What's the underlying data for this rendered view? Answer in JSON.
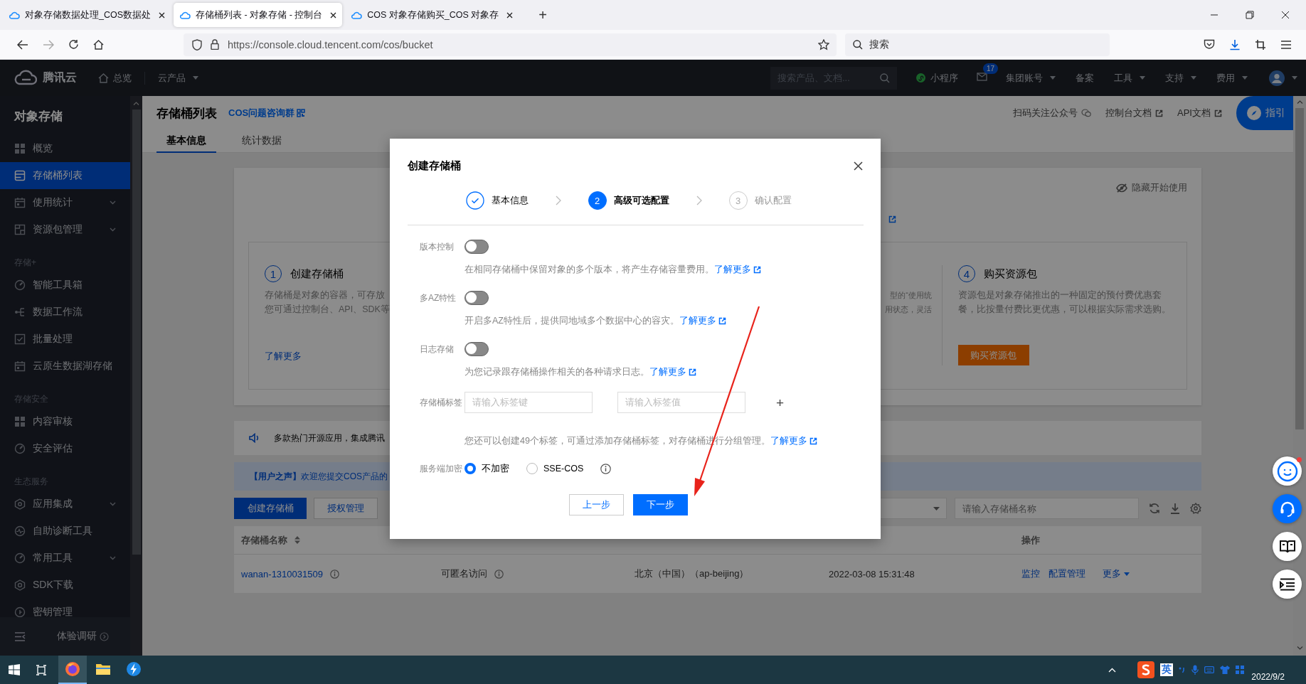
{
  "browser": {
    "tabs": [
      {
        "title": "对象存储数据处理_COS数据处",
        "selected": false
      },
      {
        "title": "存储桶列表 - 对象存储 - 控制台",
        "selected": true
      },
      {
        "title": "COS 对象存储购买_COS 对象存",
        "selected": false
      }
    ],
    "new_tab": "+",
    "url": "https://console.cloud.tencent.com/cos/bucket",
    "search_placeholder": "搜索"
  },
  "console_nav": {
    "brand": "腾讯云",
    "overview": "总览",
    "products": "云产品",
    "search_placeholder": "搜索产品、文档...",
    "mini_program": "小程序",
    "mail_badge": "17",
    "menus": [
      {
        "label": "集团账号",
        "dropdown": true
      },
      {
        "label": "备案",
        "dropdown": false
      },
      {
        "label": "工具",
        "dropdown": true
      },
      {
        "label": "支持",
        "dropdown": true
      },
      {
        "label": "费用",
        "dropdown": true
      }
    ]
  },
  "sidebar": {
    "title": "对象存储",
    "sections": [
      {
        "items": [
          {
            "label": "概览",
            "selected": false,
            "submenu": false
          },
          {
            "label": "存储桶列表",
            "selected": true,
            "submenu": false
          },
          {
            "label": "使用统计",
            "selected": false,
            "submenu": true
          },
          {
            "label": "资源包管理",
            "selected": false,
            "submenu": true
          }
        ]
      },
      {
        "heading": "存储+",
        "items": [
          {
            "label": "智能工具箱",
            "selected": false,
            "submenu": false
          },
          {
            "label": "数据工作流",
            "selected": false,
            "submenu": false
          },
          {
            "label": "批量处理",
            "selected": false,
            "submenu": false
          },
          {
            "label": "云原生数据湖存储",
            "selected": false,
            "submenu": false
          }
        ]
      },
      {
        "heading": "存储安全",
        "items": [
          {
            "label": "内容审核",
            "selected": false,
            "submenu": false
          },
          {
            "label": "安全评估",
            "selected": false,
            "submenu": false
          }
        ]
      },
      {
        "heading": "生态服务",
        "items": [
          {
            "label": "应用集成",
            "selected": false,
            "submenu": true
          },
          {
            "label": "自助诊断工具",
            "selected": false,
            "submenu": false
          },
          {
            "label": "常用工具",
            "selected": false,
            "submenu": true
          },
          {
            "label": "SDK下载",
            "selected": false,
            "submenu": false
          },
          {
            "label": "密钥管理",
            "selected": false,
            "submenu": false
          }
        ]
      }
    ],
    "footer": "体验调研"
  },
  "page": {
    "title": "存储桶列表",
    "group_link": "COS问题咨询群",
    "links": [
      {
        "label": "扫码关注公众号",
        "kind": "wechat"
      },
      {
        "label": "控制台文档",
        "kind": "external"
      },
      {
        "label": "API文档",
        "kind": "external"
      }
    ],
    "guide": "指引",
    "tabs": [
      {
        "label": "基本信息",
        "selected": true
      },
      {
        "label": "统计数据",
        "selected": false
      }
    ]
  },
  "getting_started": {
    "hide": "隐藏开始使用",
    "steps": [
      {
        "number": "1",
        "title": "创建存储桶",
        "lines": [
          "存储桶是对象的容器，可存放",
          "您可通过控制台、API、SDK等"
        ],
        "link": "了解更多"
      },
      {
        "lines": [
          "型的“使用统",
          "用状态，灵活"
        ]
      },
      {
        "number": "4",
        "title": "购买资源包",
        "lines": [
          "资源包是对象存储推出的一种固定的预付费优惠套",
          "餐，比按量付费比更优惠，可以根据实际需求选购。"
        ],
        "button": "购买资源包"
      }
    ]
  },
  "notice": "多款热门开源应用，集成腾讯",
  "feedback_banner": "**【用户之声】**欢迎您提交COS产品的",
  "toolbar": {
    "buttons": [
      {
        "label": "创建存储桶",
        "primary": true
      },
      {
        "label": "授权管理",
        "primary": false
      }
    ],
    "search_placeholder": "请输入存储桶名称"
  },
  "table": {
    "columns": [
      "存储桶名称",
      "操作"
    ],
    "rows": [
      {
        "name": "wanan-1310031509",
        "access": "可匿名访问",
        "region": "北京（中国）（ap-beijing）",
        "created": "2022-03-08 15:31:48",
        "actions": [
          "监控",
          "配置管理",
          "更多"
        ]
      }
    ]
  },
  "dialog": {
    "title": "创建存储桶",
    "steps": [
      {
        "label": "基本信息",
        "completed": true,
        "selected": false
      },
      {
        "number": "2",
        "label": "高级可选配置",
        "completed": false,
        "selected": true
      },
      {
        "number": "3",
        "label": "确认配置",
        "completed": false,
        "selected": false
      }
    ],
    "settings": [
      {
        "kind": "toggle",
        "label": "版本控制",
        "on": false,
        "help": "在相同存储桶中保留对象的多个版本，将产生存储容量费用。",
        "link": "了解更多"
      },
      {
        "kind": "toggle",
        "label": "多AZ特性",
        "on": false,
        "help": "开启多AZ特性后，提供同地域多个数据中心的容灾。",
        "link": "了解更多"
      },
      {
        "kind": "toggle",
        "label": "日志存储",
        "on": false,
        "help": "为您记录跟存储桶操作相关的各种请求日志。",
        "link": "了解更多"
      },
      {
        "kind": "tags",
        "label": "存储桶标签",
        "key_placeholder": "请输入标签键",
        "value_placeholder": "请输入标签值",
        "add": "+",
        "help": "您还可以创建49个标签，可通过添加存储桶标签，对存储桶进行分组管理。",
        "link": "了解更多"
      },
      {
        "kind": "radio",
        "label": "服务端加密",
        "options": [
          {
            "label": "不加密",
            "selected": true
          },
          {
            "label": "SSE-COS",
            "selected": false
          }
        ]
      }
    ],
    "buttons": [
      {
        "label": "上一步",
        "primary": false
      },
      {
        "label": "下一步",
        "primary": true
      }
    ]
  },
  "taskbar": {
    "apps": [
      {
        "selected": true
      },
      {
        "selected": false
      },
      {
        "selected": false
      }
    ],
    "ime": "英",
    "date": "2022/9/2"
  }
}
